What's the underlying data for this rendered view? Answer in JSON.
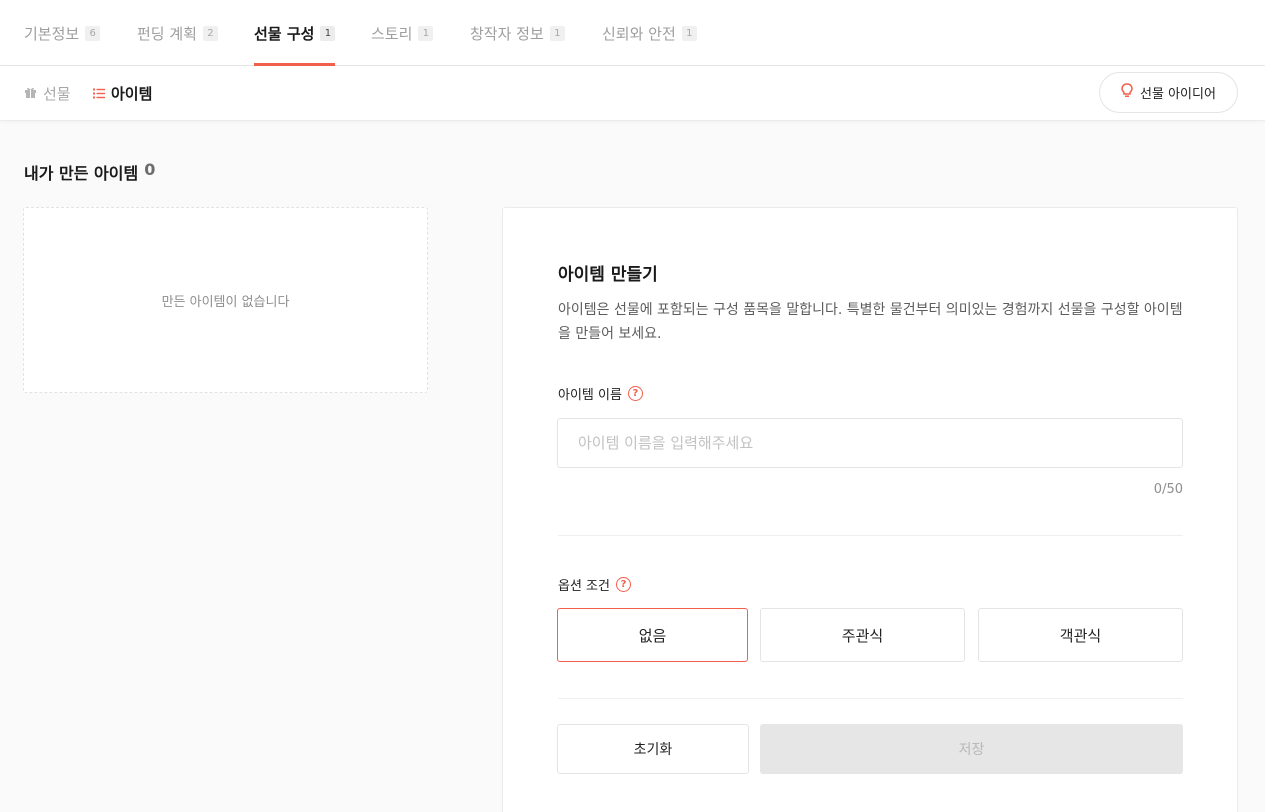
{
  "colors": {
    "accent": "#f25f4c",
    "text": "#1a1a1a",
    "muted": "#9e9e9e"
  },
  "tabs": [
    {
      "label": "기본정보",
      "count": "6"
    },
    {
      "label": "펀딩 계획",
      "count": "2"
    },
    {
      "label": "선물 구성",
      "count": "1",
      "active": true
    },
    {
      "label": "스토리",
      "count": "1"
    },
    {
      "label": "창작자 정보",
      "count": "1"
    },
    {
      "label": "신뢰와 안전",
      "count": "1"
    }
  ],
  "subtabs": {
    "gift": {
      "label": "선물",
      "icon": "gift-icon"
    },
    "item": {
      "label": "아이템",
      "icon": "list-icon",
      "active": true
    }
  },
  "idea_button": {
    "label": "선물 아이디어",
    "icon": "lightbulb-icon"
  },
  "my_items": {
    "title": "내가 만든 아이템",
    "count": "0",
    "empty_text": "만든 아이템이 없습니다"
  },
  "form": {
    "title": "아이템 만들기",
    "description": "아이템은 선물에 포함되는 구성 품목을 말합니다. 특별한 물건부터 의미있는 경험까지 선물을 구성할 아이템을 만들어 보세요.",
    "name_label": "아이템 이름",
    "name_value": "",
    "name_placeholder": "아이템 이름을 입력해주세요",
    "char_count": "0/50",
    "option_label": "옵션 조건",
    "options": [
      {
        "label": "없음",
        "selected": true
      },
      {
        "label": "주관식",
        "selected": false
      },
      {
        "label": "객관식",
        "selected": false
      }
    ],
    "reset_label": "초기화",
    "save_label": "저장"
  }
}
